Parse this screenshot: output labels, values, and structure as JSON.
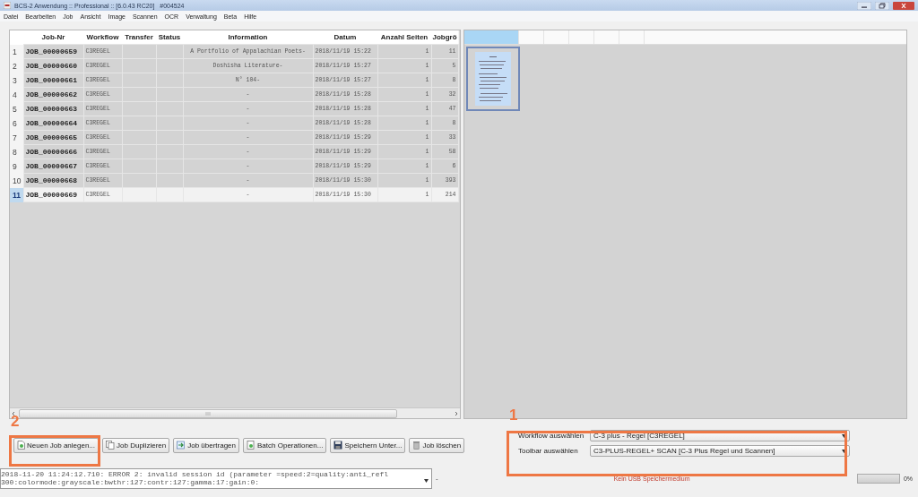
{
  "window": {
    "title": "BCS-2 Anwendung :: Professional :: [6.0.43 RC20]   #004524"
  },
  "menu": [
    "Datei",
    "Bearbeiten",
    "Job",
    "Ansicht",
    "Image",
    "Scannen",
    "OCR",
    "Verwaltung",
    "Beta",
    "Hilfe"
  ],
  "table": {
    "columns": [
      "Job-Nr",
      "Workflow",
      "Transfer",
      "Status",
      "Information",
      "Datum",
      "Anzahl Seiten",
      "Jobgrö"
    ],
    "rows": [
      {
        "number": "1",
        "cells": [
          "JOB_00000659",
          "C3REGEL",
          "",
          "",
          "A Portfolio of Appalachian Poets-",
          "2018/11/19 15:22",
          "1",
          "11"
        ],
        "selected": false
      },
      {
        "number": "2",
        "cells": [
          "JOB_00000660",
          "C3REGEL",
          "",
          "",
          "Doshisha Literature-",
          "2018/11/19 15:27",
          "1",
          "5"
        ],
        "selected": false
      },
      {
        "number": "3",
        "cells": [
          "JOB_00000661",
          "C3REGEL",
          "",
          "",
          "N° 104-",
          "2018/11/19 15:27",
          "1",
          "8"
        ],
        "selected": false
      },
      {
        "number": "4",
        "cells": [
          "JOB_00000662",
          "C3REGEL",
          "",
          "",
          "-",
          "2018/11/19 15:28",
          "1",
          "32"
        ],
        "selected": false
      },
      {
        "number": "5",
        "cells": [
          "JOB_00000663",
          "C3REGEL",
          "",
          "",
          "-",
          "2018/11/19 15:28",
          "1",
          "47"
        ],
        "selected": false
      },
      {
        "number": "6",
        "cells": [
          "JOB_00000664",
          "C3REGEL",
          "",
          "",
          "-",
          "2018/11/19 15:28",
          "1",
          "8"
        ],
        "selected": false
      },
      {
        "number": "7",
        "cells": [
          "JOB_00000665",
          "C3REGEL",
          "",
          "",
          "-",
          "2018/11/19 15:29",
          "1",
          "33"
        ],
        "selected": false
      },
      {
        "number": "8",
        "cells": [
          "JOB_00000666",
          "C3REGEL",
          "",
          "",
          "-",
          "2018/11/19 15:29",
          "1",
          "58"
        ],
        "selected": false
      },
      {
        "number": "9",
        "cells": [
          "JOB_00000667",
          "C3REGEL",
          "",
          "",
          "-",
          "2018/11/19 15:29",
          "1",
          "6"
        ],
        "selected": false
      },
      {
        "number": "10",
        "cells": [
          "JOB_00000668",
          "C3REGEL",
          "",
          "",
          "-",
          "2018/11/19 15:30",
          "1",
          "393"
        ],
        "selected": false
      },
      {
        "number": "11",
        "cells": [
          "JOB_00000669",
          "C3REGEL",
          "",
          "",
          "-",
          "2018/11/19 15:30",
          "1",
          "214"
        ],
        "selected": true
      }
    ]
  },
  "preview": {
    "pages": [
      {
        "selected": true
      }
    ]
  },
  "buttons": [
    {
      "label": "Neuen Job anlegen...",
      "kind": "new"
    },
    {
      "label": "Job Duplizieren",
      "kind": "duplicate"
    },
    {
      "label": "Job übertragen",
      "kind": "transfer"
    },
    {
      "label": "Batch Operationen...",
      "kind": "batch"
    },
    {
      "label": "Speichern Unter...",
      "kind": "save"
    },
    {
      "label": "Job löschen",
      "kind": "delete"
    }
  ],
  "selection": [
    {
      "label": "Workflow auswählen",
      "value": "C-3 plus - Regel [C3REGEL]"
    },
    {
      "label": "Toolbar auswählen",
      "value": "C3-PLUS-REGEL+ SCAN [C-3 Plus Regel und Scannen]"
    }
  ],
  "annotations": [
    {
      "label": "2"
    },
    {
      "label": "1"
    }
  ],
  "status": {
    "log": [
      "2018-11-20 11:24:12.710: ERROR 2: invalid session id (parameter =speed:2=quality:anti_refl",
      "300:colormode:grayscale:bwthr:127:contr:127:gamma:17:gain:0:"
    ],
    "separator": "-",
    "usb": "Kein USB Speichermedium",
    "progress": {
      "level": 0,
      "reading": "0%"
    }
  }
}
